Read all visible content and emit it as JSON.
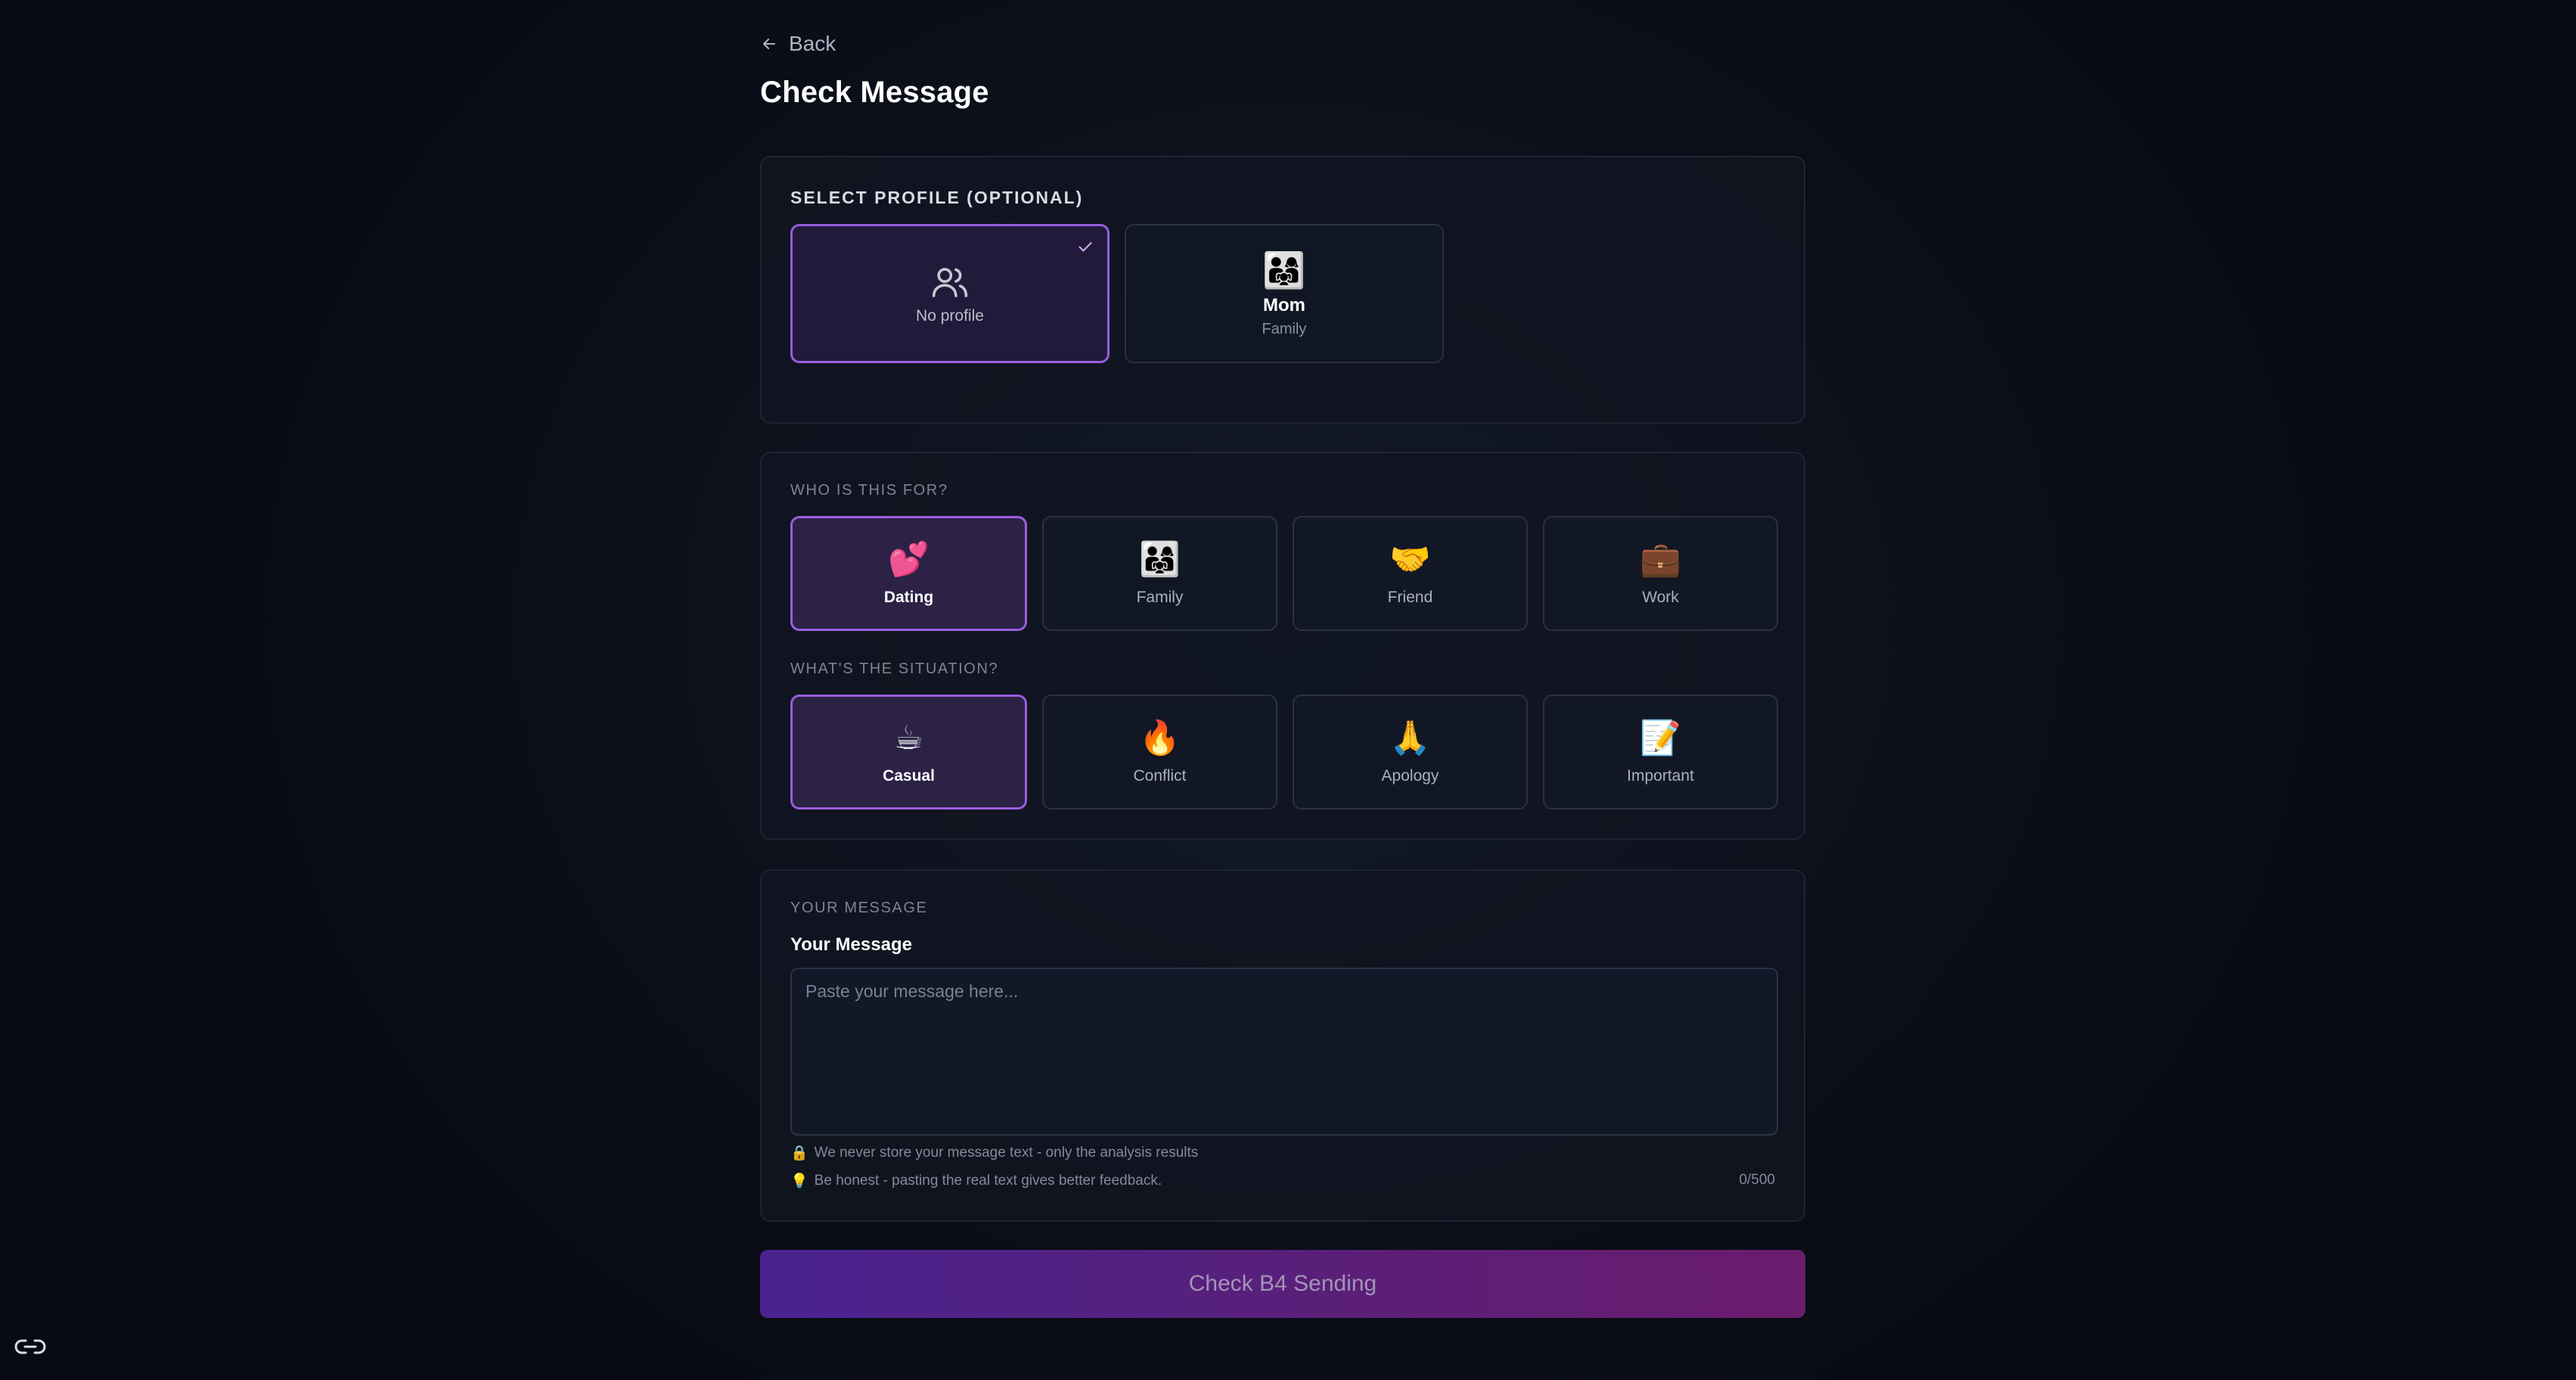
{
  "nav": {
    "back_label": "Back"
  },
  "page": {
    "title": "Check Message"
  },
  "profile_section": {
    "label": "SELECT PROFILE (OPTIONAL)",
    "profiles": [
      {
        "label": "No profile",
        "selected": true,
        "icon": "users-icon"
      },
      {
        "name": "Mom",
        "relation": "Family",
        "emoji": "👨‍👩‍👧",
        "selected": false
      }
    ]
  },
  "audience_section": {
    "label": "WHO IS THIS FOR?",
    "options": [
      {
        "emoji": "💕",
        "label": "Dating",
        "selected": true
      },
      {
        "emoji": "👨‍👩‍👧",
        "label": "Family",
        "selected": false
      },
      {
        "emoji": "🤝",
        "label": "Friend",
        "selected": false
      },
      {
        "emoji": "💼",
        "label": "Work",
        "selected": false
      }
    ]
  },
  "situation_section": {
    "label": "WHAT'S THE SITUATION?",
    "options": [
      {
        "emoji": "☕",
        "label": "Casual",
        "selected": true
      },
      {
        "emoji": "🔥",
        "label": "Conflict",
        "selected": false
      },
      {
        "emoji": "🙏",
        "label": "Apology",
        "selected": false
      },
      {
        "emoji": "📝",
        "label": "Important",
        "selected": false
      }
    ]
  },
  "message_section": {
    "label": "YOUR MESSAGE",
    "field_label": "Your Message",
    "value": "",
    "placeholder": "Paste your message here...",
    "privacy_icon": "🔒",
    "privacy_note": "We never store your message text - only the analysis results",
    "tip_icon": "💡",
    "tip_note": "Be honest - pasting the real text gives better feedback.",
    "counter": "0/500"
  },
  "submit": {
    "label": "Check B4 Sending"
  },
  "colors": {
    "accent": "#9a5de0",
    "button_start": "#4a2390",
    "button_end": "#6a1c6d",
    "background": "#0d111c"
  }
}
